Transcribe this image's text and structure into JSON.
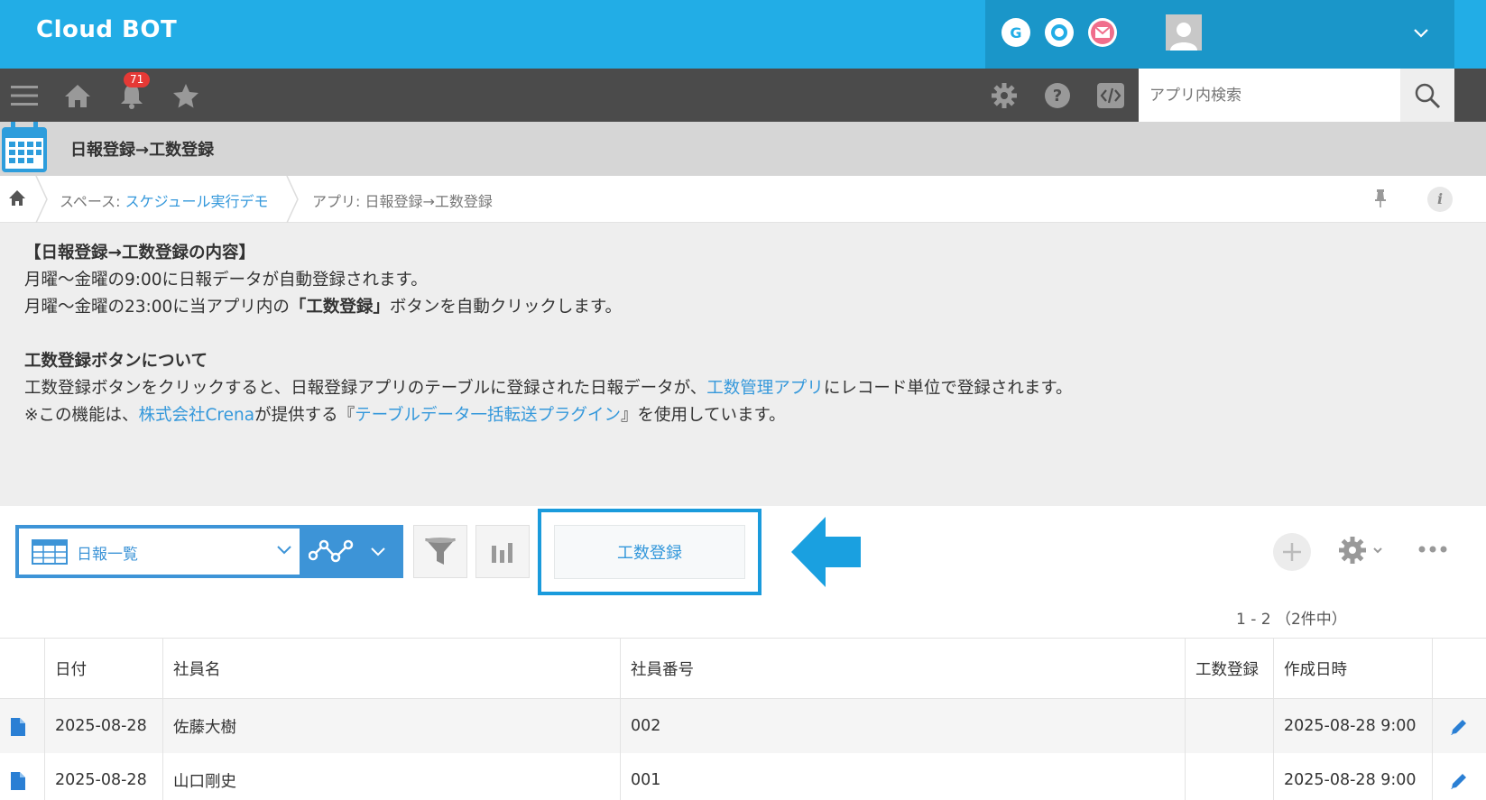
{
  "header": {
    "logo": "Cloud BOT",
    "app_icons": [
      "google-icon",
      "garoon-icon",
      "mail-icon"
    ],
    "user_avatar": "user-icon"
  },
  "navbar": {
    "notification_count": "71",
    "search_placeholder": "アプリ内検索"
  },
  "app": {
    "title": "日報登録→工数登録"
  },
  "breadcrumb": {
    "space_prefix": "スペース: ",
    "space_name": "スケジュール実行デモ",
    "app_label": "アプリ: 日報登録→工数登録"
  },
  "description": {
    "heading1": "【日報登録→工数登録の内容】",
    "line1": "月曜～金曜の9:00に日報データが自動登録されます。",
    "line2_pre": "月曜～金曜の23:00に当アプリ内の",
    "line2_bold": "「工数登録」",
    "line2_post": "ボタンを自動クリックします。",
    "heading2": "工数登録ボタンについて",
    "line3_pre": "工数登録ボタンをクリックすると、日報登録アプリのテーブルに登録された日報データが、",
    "line3_link": "工数管理アプリ",
    "line3_post": "にレコード単位で登録されます。",
    "line4_pre": "※この機能は、",
    "line4_link1": "株式会社Crena",
    "line4_mid": "が提供する『",
    "line4_link2": "テーブルデータ一括転送プラグイン",
    "line4_post": "』を使用しています。"
  },
  "toolbar": {
    "view_name": "日報一覧",
    "custom_button": "工数登録",
    "pager": "1 - 2 （2件中）"
  },
  "table": {
    "columns": [
      "日付",
      "社員名",
      "社員番号",
      "工数登録",
      "作成日時"
    ],
    "rows": [
      [
        "2025-08-28",
        "佐藤大樹",
        "002",
        "",
        "2025-08-28 9:00"
      ],
      [
        "2025-08-28",
        "山口剛史",
        "001",
        "",
        "2025-08-28 9:00"
      ]
    ]
  },
  "colors": {
    "brand": "#22ade6",
    "nav": "#4b4b4b",
    "accent": "#3d94d7",
    "link": "#3498db",
    "highlight": "#1a9bdc"
  }
}
